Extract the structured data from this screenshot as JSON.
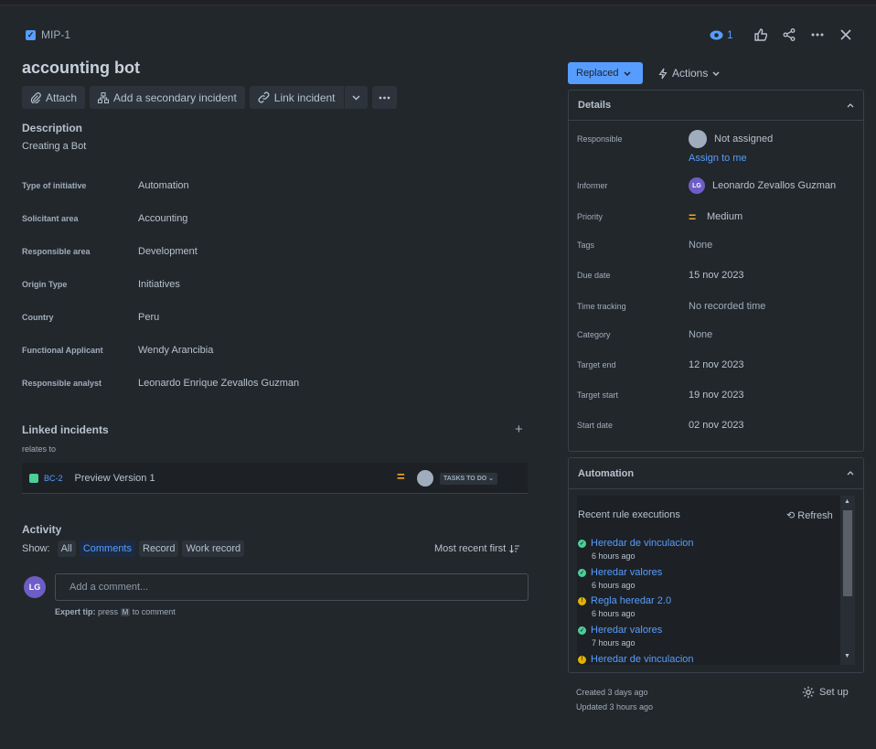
{
  "issue": {
    "key": "MIP-1",
    "title": "accounting bot",
    "watch_count": "1"
  },
  "toolbar": {
    "attach": "Attach",
    "secondary": "Add a secondary incident",
    "link": "Link incident"
  },
  "description": {
    "heading": "Description",
    "text": "Creating a Bot"
  },
  "fields": [
    {
      "label": "Type of initiative",
      "value": "Automation"
    },
    {
      "label": "Solicitant area",
      "value": "Accounting"
    },
    {
      "label": "Responsible area",
      "value": "Development"
    },
    {
      "label": "Origin Type",
      "value": "Initiatives"
    },
    {
      "label": "Country",
      "value": "Peru"
    },
    {
      "label": "Functional Applicant",
      "value": "Wendy Arancibia"
    },
    {
      "label": "Responsible analyst",
      "value": "Leonardo Enrique Zevallos Guzman"
    }
  ],
  "linked": {
    "heading": "Linked incidents",
    "relation": "relates to",
    "item": {
      "key": "BC-2",
      "summary": "Preview Version 1",
      "status": "TASKS TO DO"
    }
  },
  "activity": {
    "heading": "Activity",
    "show_label": "Show:",
    "filters": [
      "All",
      "Comments",
      "Record",
      "Work record"
    ],
    "sort": "Most recent first",
    "avatar_initials": "LG",
    "comment_placeholder": "Add a comment...",
    "tip_prefix": "Expert tip:",
    "tip_press": "press",
    "tip_key": "M",
    "tip_suffix": "to comment"
  },
  "status_button": "Replaced",
  "actions_button": "Actions",
  "details": {
    "heading": "Details",
    "responsible_label": "Responsible",
    "responsible_value": "Not assigned",
    "assign_to_me": "Assign to me",
    "informer_label": "Informer",
    "informer_initials": "LG",
    "informer_value": "Leonardo Zevallos Guzman",
    "priority_label": "Priority",
    "priority_value": "Medium",
    "tags_label": "Tags",
    "tags_value": "None",
    "due_label": "Due date",
    "due_value": "15 nov 2023",
    "time_label": "Time tracking",
    "time_value": "No recorded time",
    "category_label": "Category",
    "category_value": "None",
    "target_end_label": "Target end",
    "target_end_value": "12 nov 2023",
    "target_start_label": "Target start",
    "target_start_value": "19 nov 2023",
    "start_label": "Start date",
    "start_value": "02 nov 2023"
  },
  "automation": {
    "heading": "Automation",
    "recent": "Recent rule executions",
    "refresh": "Refresh",
    "rules": [
      {
        "name": "Heredar de vinculacion",
        "time": "6 hours ago",
        "status": "ok"
      },
      {
        "name": "Heredar valores",
        "time": "6 hours ago",
        "status": "ok"
      },
      {
        "name": "Regla heredar 2.0",
        "time": "6 hours ago",
        "status": "warn"
      },
      {
        "name": "Heredar valores",
        "time": "7 hours ago",
        "status": "ok"
      },
      {
        "name": "Heredar de vinculacion",
        "time": "",
        "status": "warn"
      }
    ]
  },
  "footer": {
    "created": "Created 3 days ago",
    "updated": "Updated 3 hours ago",
    "setup": "Set up"
  },
  "colors": {
    "background": "#22272b",
    "accent": "#579dff",
    "success": "#4bce97",
    "warning": "#e2b203",
    "priority_medium": "#f5a623"
  }
}
